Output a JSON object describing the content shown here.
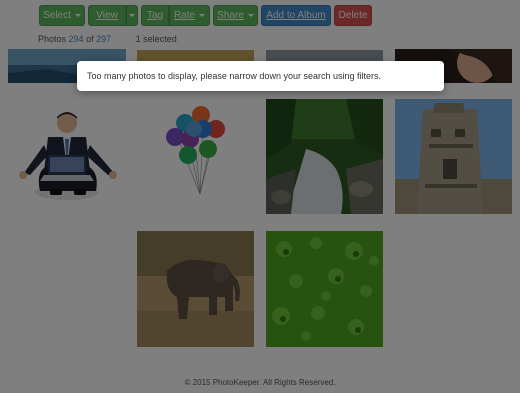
{
  "toolbar": {
    "select": "Select",
    "view": "View",
    "tag": "Tag",
    "rate": "Rate",
    "share": "Share",
    "add_to_album": "Add to Album",
    "delete": "Delete"
  },
  "status": {
    "prefix": "Photos",
    "shown": "294",
    "of": "of",
    "total": "297",
    "selected": "1 selected"
  },
  "notice": "Too many photos to display, please narrow down your search using filters.",
  "footer": "© 2015 PhotoKeeper. All Rights Reserved.",
  "colors": {
    "success": "#5cb85c",
    "primary": "#428bca",
    "danger": "#d9534f"
  }
}
